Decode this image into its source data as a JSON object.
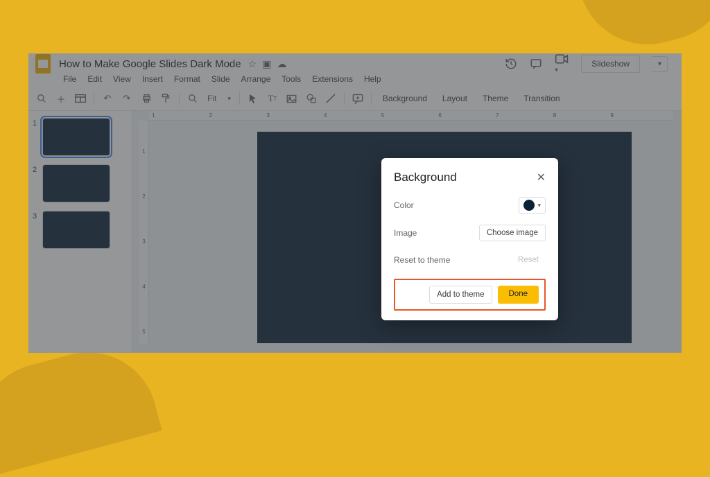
{
  "header": {
    "doc_title": "How to Make Google Slides Dark Mode",
    "slideshow_label": "Slideshow"
  },
  "menus": [
    "File",
    "Edit",
    "View",
    "Insert",
    "Format",
    "Slide",
    "Arrange",
    "Tools",
    "Extensions",
    "Help"
  ],
  "toolbar": {
    "fit_label": "Fit",
    "buttons": [
      "Background",
      "Layout",
      "Theme",
      "Transition"
    ]
  },
  "thumbnails": [
    {
      "num": "1",
      "selected": true
    },
    {
      "num": "2",
      "selected": false
    },
    {
      "num": "3",
      "selected": false
    }
  ],
  "ruler_h": "1 2 3 4 5 6 7 8 9",
  "ruler_v": [
    "1",
    "2",
    "3",
    "4",
    "5"
  ],
  "dialog": {
    "title": "Background",
    "row_color_label": "Color",
    "row_image_label": "Image",
    "choose_image_label": "Choose image",
    "row_reset_label": "Reset to theme",
    "reset_label": "Reset",
    "add_to_theme_label": "Add to theme",
    "done_label": "Done",
    "color_hex": "#0b2135"
  }
}
